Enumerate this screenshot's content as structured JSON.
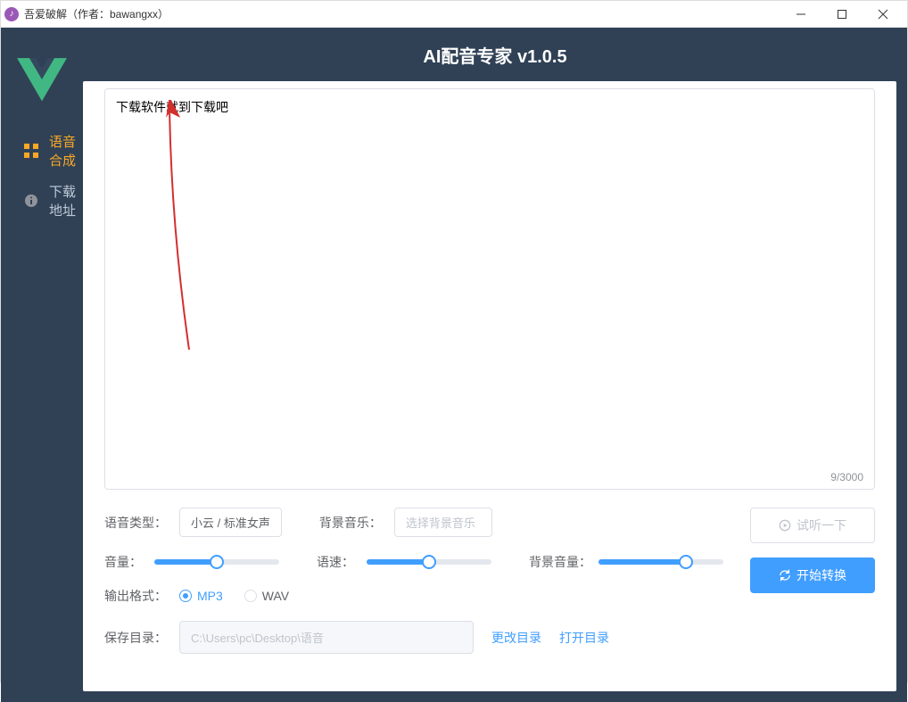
{
  "titlebar": {
    "text": "吾爱破解（作者：bawangxx）"
  },
  "header": {
    "app_title": "AI配音专家 v1.0.5"
  },
  "sidebar": {
    "items": [
      {
        "label": "语音合成",
        "active": true
      },
      {
        "label": "下载地址",
        "active": false
      }
    ]
  },
  "textarea": {
    "value": "下载软件就到下载吧",
    "char_count": "9/3000"
  },
  "controls": {
    "voice_type_label": "语音类型：",
    "voice_type_value": "小云 / 标准女声",
    "bg_music_label": "背景音乐：",
    "bg_music_placeholder": "选择背景音乐",
    "volume_label": "音量：",
    "volume_value": 50,
    "speed_label": "语速：",
    "speed_value": 50,
    "bg_volume_label": "背景音量：",
    "bg_volume_value": 70,
    "output_format_label": "输出格式：",
    "formats": {
      "mp3": "MP3",
      "wav": "WAV"
    },
    "selected_format": "mp3",
    "save_dir_label": "保存目录：",
    "save_dir_value": "C:\\Users\\pc\\Desktop\\语音",
    "change_dir_label": "更改目录",
    "open_dir_label": "打开目录"
  },
  "buttons": {
    "preview_label": "试听一下",
    "convert_label": "开始转换"
  }
}
